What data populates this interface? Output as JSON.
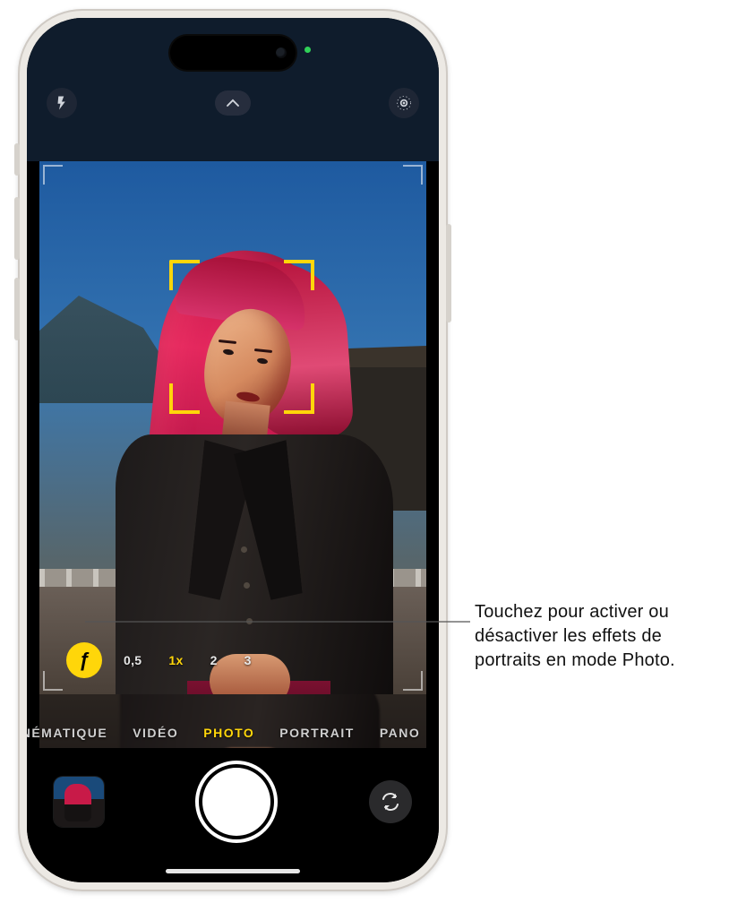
{
  "top": {
    "flash_icon": "flash",
    "chevron_icon": "chevron-up",
    "livephoto_icon": "live-photo"
  },
  "zoom": {
    "depth_symbol": "ƒ",
    "options": [
      "0,5",
      "1x",
      "2",
      "3"
    ],
    "active_index": 1
  },
  "modes": {
    "items": [
      "CINÉMATIQUE",
      "VIDÉO",
      "PHOTO",
      "PORTRAIT",
      "PANO"
    ],
    "active_index": 2
  },
  "bottom": {
    "thumbnail": "last-photo",
    "shutter": "shutter",
    "flip": "flip-camera"
  },
  "callout": {
    "text": "Touchez pour activer ou désactiver les effets de portraits en mode Photo."
  },
  "colors": {
    "accent": "#ffd60a"
  }
}
